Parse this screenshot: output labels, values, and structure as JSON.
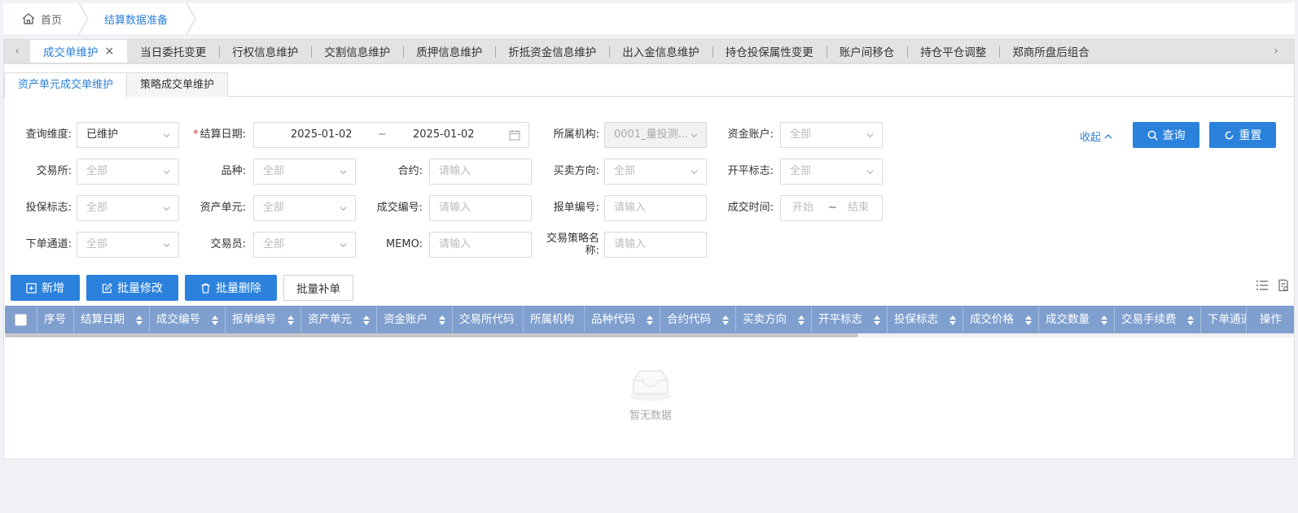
{
  "breadcrumb": {
    "home": "首页",
    "current": "结算数据准备"
  },
  "tabs": [
    {
      "label": "成交单维护",
      "active": true
    },
    {
      "label": "当日委托变更"
    },
    {
      "label": "行权信息维护"
    },
    {
      "label": "交割信息维护"
    },
    {
      "label": "质押信息维护"
    },
    {
      "label": "折抵资金信息维护"
    },
    {
      "label": "出入金信息维护"
    },
    {
      "label": "持仓投保属性变更"
    },
    {
      "label": "账户间移仓"
    },
    {
      "label": "持仓平仓调整"
    },
    {
      "label": "郑商所盘后组合"
    }
  ],
  "tab_close": "×",
  "tab_prev": "‹",
  "tab_next": "›",
  "subtabs": [
    "资产单元成交单维护",
    "策略成交单维护"
  ],
  "filters": {
    "query_dim": {
      "label": "查询维度:",
      "value": "已维护"
    },
    "settle_date": {
      "label": "结算日期:",
      "required": "*",
      "start": "2025-01-02",
      "sep": "~",
      "end": "2025-01-02"
    },
    "org": {
      "label": "所属机构:",
      "value": "0001_量投测..."
    },
    "fund_account": {
      "label": "资金账户:",
      "placeholder": "全部"
    },
    "exchange": {
      "label": "交易所:",
      "placeholder": "全部"
    },
    "variety": {
      "label": "品种:",
      "placeholder": "全部"
    },
    "contract": {
      "label": "合约:",
      "placeholder": "请输入"
    },
    "direction": {
      "label": "买卖方向:",
      "placeholder": "全部"
    },
    "open_close": {
      "label": "开平标志:",
      "placeholder": "全部"
    },
    "hedge": {
      "label": "投保标志:",
      "placeholder": "全部"
    },
    "asset_unit": {
      "label": "资产单元:",
      "placeholder": "全部"
    },
    "trade_no": {
      "label": "成交编号:",
      "placeholder": "请输入"
    },
    "order_no": {
      "label": "报单编号:",
      "placeholder": "请输入"
    },
    "trade_time": {
      "label": "成交时间:",
      "start": "开始",
      "sep": "~",
      "end": "结束"
    },
    "channel": {
      "label": "下单通道:",
      "placeholder": "全部"
    },
    "trader": {
      "label": "交易员:",
      "placeholder": "全部"
    },
    "memo": {
      "label": "MEMO:",
      "placeholder": "请输入"
    },
    "strategy_name": {
      "label_line1": "交易策略名",
      "label_line2": "称:",
      "placeholder": "请输入"
    }
  },
  "actions": {
    "collapse": "收起",
    "query": "查询",
    "reset": "重置",
    "add": "新增",
    "batch_edit": "批量修改",
    "batch_delete": "批量删除",
    "batch_supplement": "批量补单"
  },
  "table": {
    "columns": [
      "序号",
      "结算日期",
      "成交编号",
      "报单编号",
      "资产单元",
      "资金账户",
      "交易所代码",
      "所属机构",
      "品种代码",
      "合约代码",
      "买卖方向",
      "开平标志",
      "投保标志",
      "成交价格",
      "成交数量",
      "交易手续费",
      "下单通道",
      "操作"
    ],
    "empty_text": "暂无数据"
  },
  "colors": {
    "primary": "#2b82dd",
    "header": "#7f9fcf",
    "link": "#2b7fd8"
  }
}
